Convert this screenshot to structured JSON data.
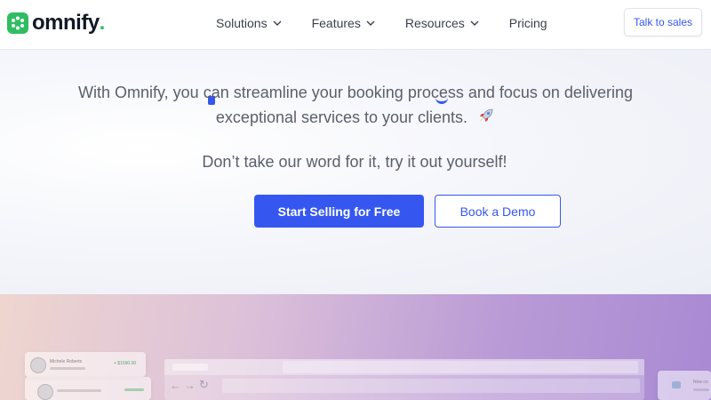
{
  "brand": {
    "name": "omnify",
    "dot": "."
  },
  "nav": {
    "items": [
      {
        "label": "Solutions",
        "has_dropdown": true
      },
      {
        "label": "Features",
        "has_dropdown": true
      },
      {
        "label": "Resources",
        "has_dropdown": true
      },
      {
        "label": "Pricing",
        "has_dropdown": false
      }
    ],
    "cta_label": "Talk to sales"
  },
  "hero": {
    "subtitle_line1": "With Omnify, you can streamline your booking process and focus on delivering",
    "subtitle_line2": "exceptional services to your clients.",
    "subtitle_icon": "rocket-icon",
    "tagline": "Don’t take our word for it, try it out yourself!",
    "primary_button": "Start Selling for Free",
    "secondary_button": "Book a Demo"
  },
  "preview": {
    "card_name": "Michele Roberts",
    "card_amount": "+ $1590.00",
    "side_label": "Now co"
  },
  "colors": {
    "accent": "#3557f0",
    "brand_green": "#2fbd61"
  }
}
